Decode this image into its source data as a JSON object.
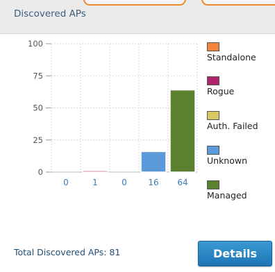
{
  "panel": {
    "title": "Discovered APs"
  },
  "colors": {
    "standalone": "#f5843a",
    "rogue": "#b1246c",
    "auth_failed": "#d9c761",
    "unknown": "#5b9ad8",
    "managed": "#5a8030",
    "value_label": "#3d7ab8",
    "details_button": "#2583c4"
  },
  "legend": [
    {
      "label": "Standalone",
      "color": "#f5843a"
    },
    {
      "label": "Rogue",
      "color": "#b1246c"
    },
    {
      "label": "Auth. Failed",
      "color": "#d9c761"
    },
    {
      "label": "Unknown",
      "color": "#5b9ad8"
    },
    {
      "label": "Managed",
      "color": "#5a8030"
    }
  ],
  "chart_data": {
    "type": "bar",
    "categories": [
      "Standalone",
      "Rogue",
      "Auth. Failed",
      "Unknown",
      "Managed"
    ],
    "values": [
      0,
      1,
      0,
      16,
      64
    ],
    "value_labels": [
      "0",
      "1",
      "0",
      "16",
      "64"
    ],
    "colors": [
      "#f5843a",
      "#b1246c",
      "#d9c761",
      "#5b9ad8",
      "#5a8030"
    ],
    "ylim": [
      0,
      100
    ],
    "yticks": [
      "0",
      "25",
      "50",
      "75",
      "100"
    ],
    "grid": true,
    "legend_position": "right"
  },
  "footer": {
    "total_text": "Total Discovered APs: 81",
    "details_label": "Details"
  }
}
